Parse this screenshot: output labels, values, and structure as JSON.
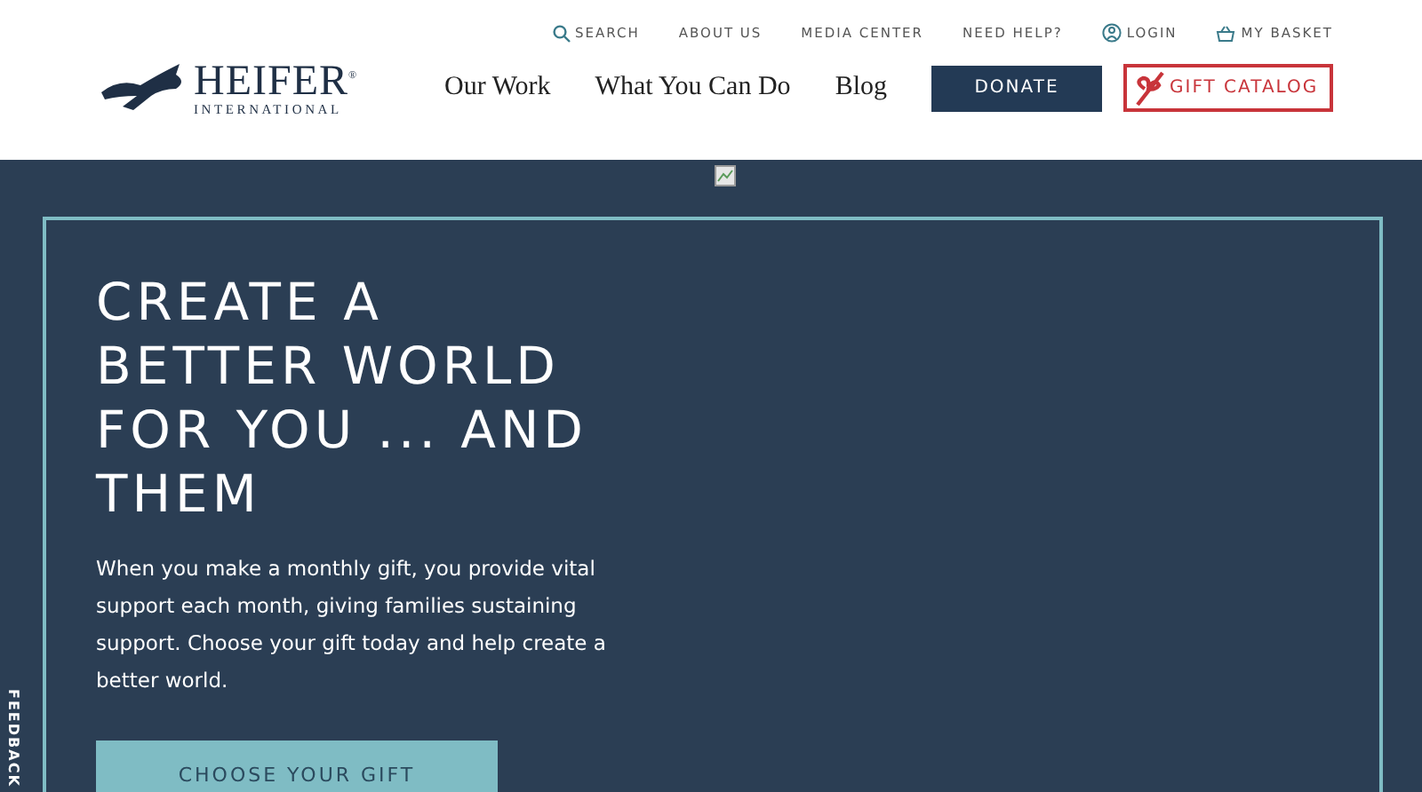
{
  "utility_nav": [
    {
      "label": "SEARCH",
      "kind": "search"
    },
    {
      "label": "ABOUT US",
      "kind": "plain"
    },
    {
      "label": "MEDIA CENTER",
      "kind": "plain"
    },
    {
      "label": "NEED HELP?",
      "kind": "plain"
    },
    {
      "label": "LOGIN",
      "kind": "login"
    },
    {
      "label": "MY BASKET",
      "kind": "basket"
    }
  ],
  "logo": {
    "name": "HEIFER",
    "sub": "INTERNATIONAL",
    "mark": "®"
  },
  "main_nav": [
    "Our Work",
    "What You Can Do",
    "Blog"
  ],
  "donate": "DONATE",
  "gift_catalog": "GIFT CATALOG",
  "hero": {
    "heading": "CREATE A BETTER WORLD FOR YOU ... AND THEM",
    "text": "When you make a monthly gift, you provide vital support each month, giving families sustaining support. Choose your gift today and help create a better world.",
    "button": "CHOOSE YOUR GIFT"
  },
  "feedback": "FEEDBACK"
}
